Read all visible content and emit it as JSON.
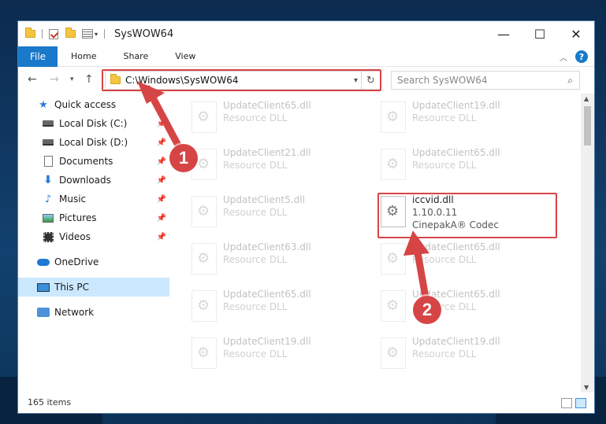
{
  "window": {
    "title": "SysWOW64"
  },
  "controls": {
    "minimize": "—",
    "maximize": "☐",
    "close": "✕"
  },
  "ribbon": {
    "tabs": [
      "File",
      "Home",
      "Share",
      "View"
    ],
    "help": "?"
  },
  "address": {
    "path": "C:\\Windows\\SysWOW64"
  },
  "search": {
    "placeholder": "Search SysWOW64"
  },
  "sidebar": {
    "quick_access": "Quick access",
    "items": [
      "Local Disk (C:)",
      "Local Disk (D:)",
      "Documents",
      "Downloads",
      "Music",
      "Pictures",
      "Videos"
    ],
    "onedrive": "OneDrive",
    "this_pc": "This PC",
    "network": "Network"
  },
  "files": [
    {
      "name": "UpdateClient65.dll",
      "desc": "Resource DLL"
    },
    {
      "name": "UpdateClient19.dll",
      "desc": "Resource DLL"
    },
    {
      "name": "UpdateClient21.dll",
      "desc": "Resource DLL"
    },
    {
      "name": "UpdateClient65.dll",
      "desc": "Resource DLL"
    },
    {
      "name": "UpdateClient5.dll",
      "desc": "Resource DLL"
    },
    {
      "name": "UpdateClient63.dll",
      "desc": "Resource DLL"
    },
    {
      "name": "UpdateClient65.dll",
      "desc": "Resource DLL"
    },
    {
      "name": "UpdateClient65.dll",
      "desc": "Resource DLL"
    },
    {
      "name": "UpdateClient65.dll",
      "desc": "Resource DLL"
    },
    {
      "name": "UpdateClient19.dll",
      "desc": "Resource DLL"
    },
    {
      "name": "UpdateClient19.dll",
      "desc": "Resource DLL"
    }
  ],
  "highlighted_file": {
    "name": "iccvid.dll",
    "version": "1.10.0.11",
    "desc": "CinepakA® Codec"
  },
  "status": {
    "items": "165 items"
  },
  "annotations": {
    "step1": "1",
    "step2": "2"
  },
  "colors": {
    "accent": "#1979ca",
    "highlight": "#d94444",
    "selected": "#cce8ff"
  }
}
